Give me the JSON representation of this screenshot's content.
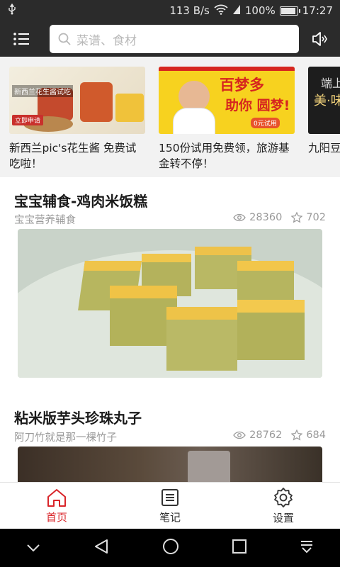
{
  "status": {
    "speed": "113 B/s",
    "battery": "100%",
    "battery_level": 1.0,
    "time": "17:27"
  },
  "search": {
    "placeholder": "菜谱、食材"
  },
  "banners": [
    {
      "title": "新西兰pic's花生酱 免费试吃啦！",
      "image_text": "新西兰花生酱试吃",
      "image_sub": "立即申请"
    },
    {
      "title": "150份试用免费领，旅游基金转不停！",
      "image_text": "百梦多",
      "image_sub": "助你 圆梦!",
      "image_tag": "0元试用"
    },
    {
      "title": "九阳豆浆机试用",
      "image_text": "端上",
      "image_sub": "美·味"
    }
  ],
  "recipes": [
    {
      "title": "宝宝辅食-鸡肉米饭糕",
      "author": "宝宝营养辅食",
      "views": "28360",
      "favorites": "702"
    },
    {
      "title": "粘米版芋头珍珠丸子",
      "author": "阿刀竹就是那一棵竹子",
      "views": "28762",
      "favorites": "684"
    }
  ],
  "tabs": [
    {
      "label": "首页",
      "icon": "home-icon",
      "active": true
    },
    {
      "label": "笔记",
      "icon": "notes-icon",
      "active": false
    },
    {
      "label": "设置",
      "icon": "gear-icon",
      "active": false
    }
  ],
  "colors": {
    "accent": "#d9252a",
    "topbar": "#2b2b2b"
  }
}
